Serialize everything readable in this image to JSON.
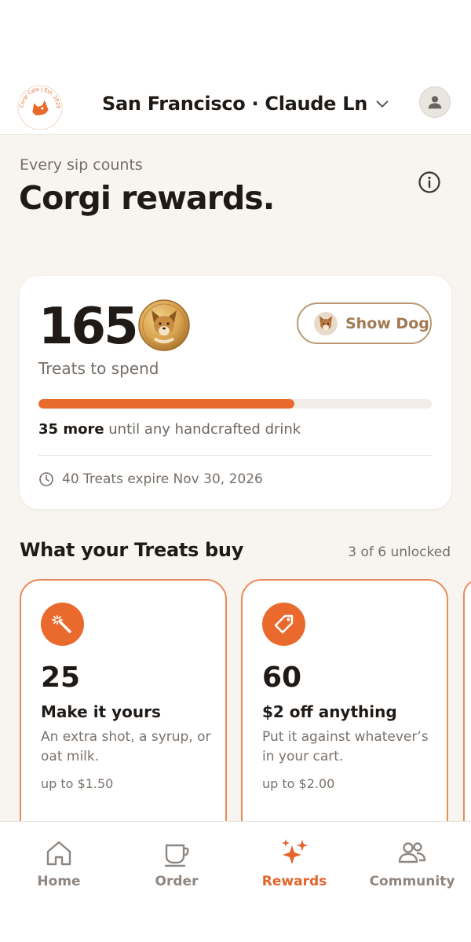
{
  "header": {
    "location": "San Francisco · Claude Ln",
    "logo_text": "Corgi Cafe | Est. 2025"
  },
  "page": {
    "eyebrow": "Every sip counts",
    "title": "Corgi rewards."
  },
  "balance": {
    "value": "165",
    "label": "Treats to spend",
    "show_dog_label": "Show Dog",
    "progress_fraction": 0.65,
    "progress_emphasis": "35 more",
    "progress_rest": "until any handcrafted drink",
    "expiry_text": "40 Treats expire Nov 30, 2026"
  },
  "rewards_section": {
    "title": "What your Treats buy",
    "meta": "3 of 6 unlocked",
    "cards": [
      {
        "icon": "magic-wand-icon",
        "cost": "25",
        "name": "Make it yours",
        "description": "An extra shot, a syrup, or oat milk.",
        "cap": "up to $1.50"
      },
      {
        "icon": "tag-icon",
        "cost": "60",
        "name": "$2 off anything",
        "description": "Put it against whatever’s in your cart.",
        "cap": "up to $2.00"
      }
    ]
  },
  "tabs": [
    {
      "label": "Home",
      "icon": "home-icon",
      "active": false
    },
    {
      "label": "Order",
      "icon": "cup-icon",
      "active": false
    },
    {
      "label": "Rewards",
      "icon": "sparkles-icon",
      "active": true
    },
    {
      "label": "Community",
      "icon": "people-icon",
      "active": false
    }
  ],
  "colors": {
    "accent": "#EA6A2D",
    "background": "#F8F5F1",
    "card_border": "#EA8A5A",
    "show_dog_border": "#B99873",
    "text": "#1F1A16",
    "muted": "#766E68"
  }
}
